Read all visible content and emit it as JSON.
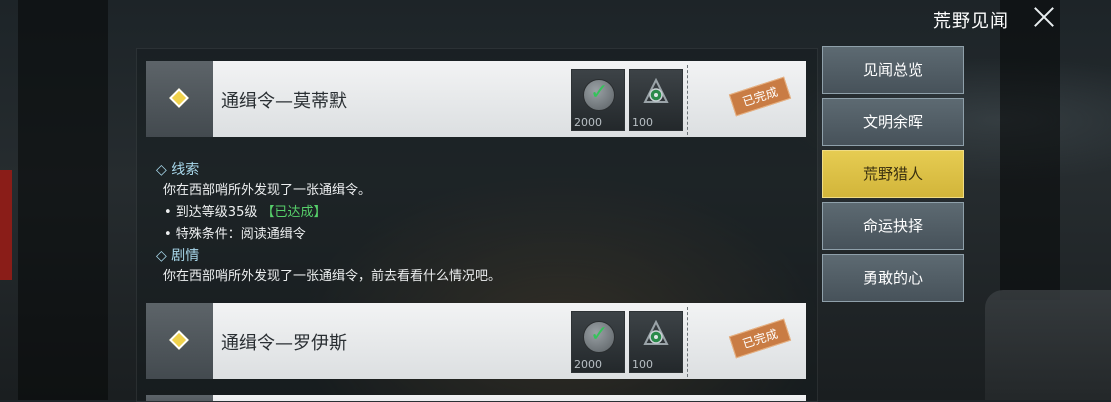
{
  "header": {
    "title": "荒野见闻"
  },
  "nav": [
    {
      "label": "见闻总览",
      "active": false
    },
    {
      "label": "文明余晖",
      "active": false
    },
    {
      "label": "荒野猎人",
      "active": true
    },
    {
      "label": "命运抉择",
      "active": false
    },
    {
      "label": "勇敢的心",
      "active": false
    }
  ],
  "cards": [
    {
      "name": "通缉令—莫蒂默",
      "reward1": "2000",
      "reward2": "100",
      "status": "已完成"
    },
    {
      "name": "通缉令—罗伊斯",
      "reward1": "2000",
      "reward2": "100",
      "status": "已完成"
    }
  ],
  "detail": {
    "clue_title": "◇ 线索",
    "clue_text": "你在西部哨所外发现了一张通缉令。",
    "req1": "• 到达等级35级",
    "req1_status": "【已达成】",
    "req2": "• 特殊条件：阅读通缉令",
    "story_title": "◇ 剧情",
    "story_text": "你在西部哨所外发现了一张通缉令，前去看看什么情况吧。"
  },
  "colors": {
    "accent_nav": "#d9bd42",
    "done_stamp": "#c97c44",
    "achieved": "#57d06b"
  }
}
